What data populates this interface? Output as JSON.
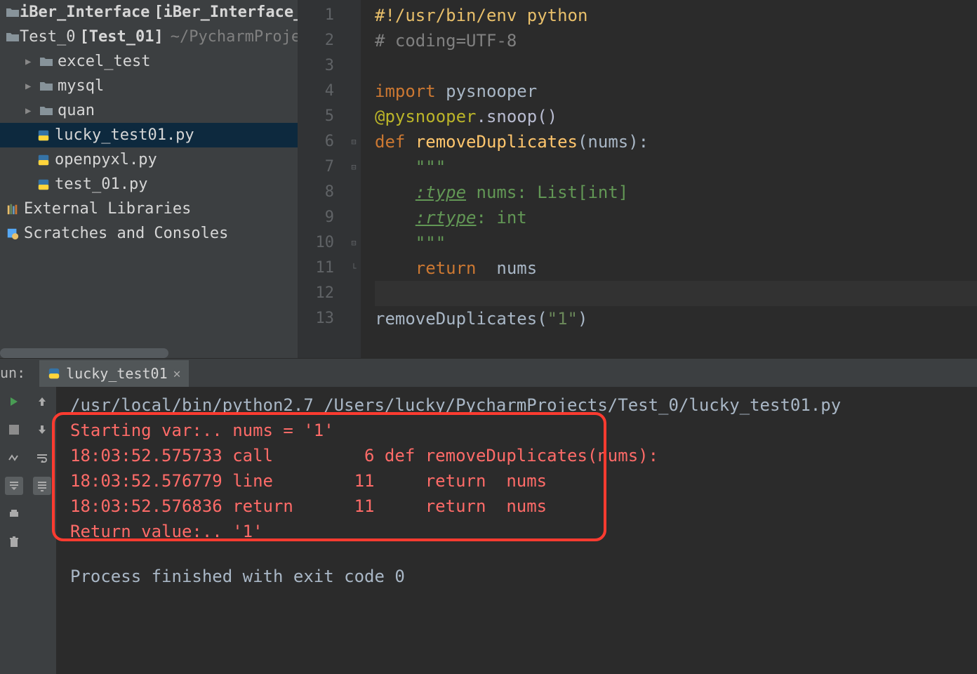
{
  "tree": {
    "root1": {
      "name": "iBer_Interface",
      "bold_name": "[iBer_Interface_Te"
    },
    "root2": {
      "name": "Test_0",
      "bold_name": "[Test_01]",
      "path": "~/PycharmProje"
    },
    "folders": [
      "excel_test",
      "mysql",
      "quan"
    ],
    "files": [
      "lucky_test01.py",
      "openpyxl.py",
      "test_01.py"
    ],
    "external": "External Libraries",
    "scratches": "Scratches and Consoles"
  },
  "editor": {
    "line_count": 13,
    "lines": {
      "l1a": "#!/usr/bin/env python",
      "l2a": "# coding=UTF-8",
      "l4a": "import ",
      "l4b": "pysnooper",
      "l5a": "@pysnooper",
      "l5b": ".snoop()",
      "l6a": "def ",
      "l6b": "removeDuplicates",
      "l6c": "(nums):",
      "l7a": "\"\"\"",
      "l8a": ":type",
      "l8b": " nums: List[int]",
      "l9a": ":rtype",
      "l9b": ": int",
      "l10a": "\"\"\"",
      "l11a": "return  ",
      "l11b": "nums",
      "l13a": "removeDuplicates(",
      "l13b": "\"1\"",
      "l13c": ")"
    }
  },
  "run": {
    "label": "un:",
    "tab_name": "lucky_test01",
    "cmd": "/usr/local/bin/python2.7 /Users/lucky/PycharmProjects/Test_0/lucky_test01.py",
    "out1": "Starting var:.. nums = '1'",
    "out2": "18:03:52.575733 call         6 def removeDuplicates(nums):",
    "out3": "18:03:52.576779 line        11     return  nums",
    "out4": "18:03:52.576836 return      11     return  nums",
    "out5": "Return value:.. '1'",
    "exit": "Process finished with exit code 0"
  }
}
